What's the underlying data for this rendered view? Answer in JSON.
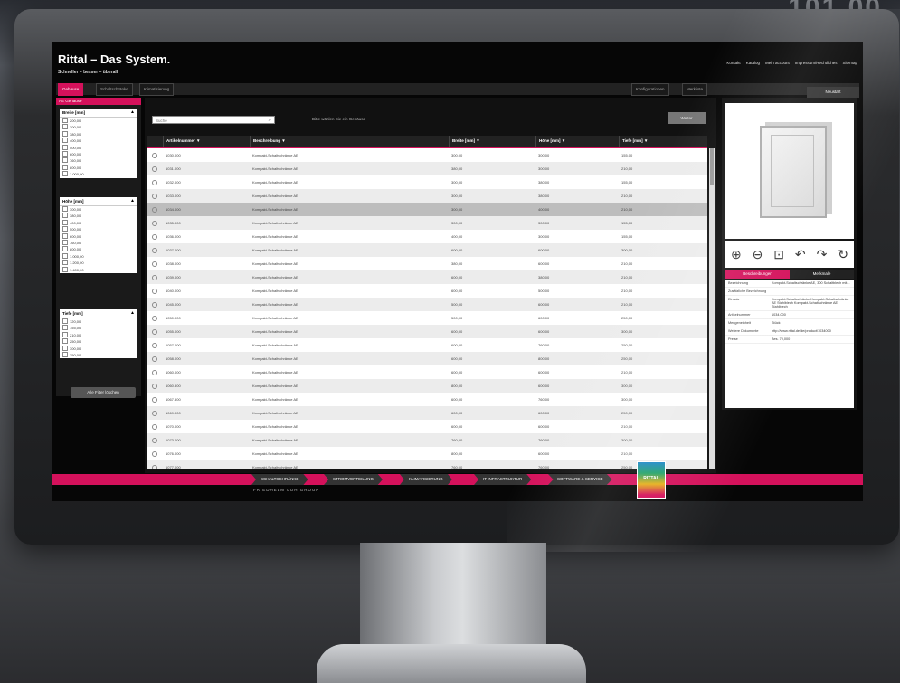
{
  "background": {
    "numbers": "101 00"
  },
  "header": {
    "title": "Rittal – Das System.",
    "tagline": "Schneller – besser – überall",
    "nav": [
      "Kontakt",
      "Katalog",
      "Mein account",
      "Impressum/Rechtliches",
      "Sitemap"
    ]
  },
  "tabs": [
    "Gehäuse",
    "Schaltschränke",
    "Klimatisierung"
  ],
  "tabs_right": [
    "Konfigurationen",
    "Merkliste"
  ],
  "topright_button": "Neustart",
  "left": {
    "head": "AE Gehäuse",
    "filters": [
      {
        "title": "Breite [mm]",
        "items": [
          "200,00",
          "300,00",
          "380,00",
          "400,00",
          "500,00",
          "600,00",
          "760,00",
          "800,00",
          "1.000,00"
        ]
      },
      {
        "title": "Höhe [mm]",
        "items": [
          "300,00",
          "380,00",
          "400,00",
          "500,00",
          "600,00",
          "760,00",
          "800,00",
          "1.000,00",
          "1.200,00",
          "1.400,00"
        ]
      },
      {
        "title": "Tiefe [mm]",
        "items": [
          "120,00",
          "155,00",
          "210,00",
          "250,00",
          "300,00",
          "350,00"
        ]
      }
    ],
    "filter_button": "Alle Filter löschen"
  },
  "main": {
    "search_placeholder": "Suche",
    "hint": "Bitte wählen Sie ein Gehäuse",
    "reset": "Weiter",
    "columns": [
      "Artikelnummer ▼",
      "Beschreibung ▼",
      "Breite [mm] ▼",
      "Höhe [mm] ▼",
      "Tiefe [mm] ▼"
    ],
    "rows": [
      [
        "1030.000",
        "Kompakt-Schaltschränke AE",
        "300,00",
        "300,00",
        "155,00"
      ],
      [
        "1031.000",
        "Kompakt-Schaltschränke AE",
        "380,00",
        "300,00",
        "210,00"
      ],
      [
        "1032.000",
        "Kompakt-Schaltschränke AE",
        "300,00",
        "380,00",
        "155,00"
      ],
      [
        "1033.000",
        "Kompakt-Schaltschränke AE",
        "300,00",
        "380,00",
        "210,00"
      ],
      [
        "1034.000",
        "Kompakt-Schaltschränke AE",
        "300,00",
        "400,00",
        "210,00"
      ],
      [
        "1035.000",
        "Kompakt-Schaltschränke AE",
        "300,00",
        "300,00",
        "155,00"
      ],
      [
        "1036.000",
        "Kompakt-Schaltschränke AE",
        "400,00",
        "300,00",
        "155,00"
      ],
      [
        "1037.000",
        "Kompakt-Schaltschränke AE",
        "600,00",
        "600,00",
        "300,00"
      ],
      [
        "1038.000",
        "Kompakt-Schaltschränke AE",
        "380,00",
        "600,00",
        "210,00"
      ],
      [
        "1039.000",
        "Kompakt-Schaltschränke AE",
        "600,00",
        "380,00",
        "210,00"
      ],
      [
        "1040.000",
        "Kompakt-Schaltschränke AE",
        "600,00",
        "500,00",
        "210,00"
      ],
      [
        "1045.000",
        "Kompakt-Schaltschränke AE",
        "500,00",
        "600,00",
        "210,00"
      ],
      [
        "1050.000",
        "Kompakt-Schaltschränke AE",
        "500,00",
        "600,00",
        "250,00"
      ],
      [
        "1055.000",
        "Kompakt-Schaltschränke AE",
        "600,00",
        "600,00",
        "300,00"
      ],
      [
        "1057.000",
        "Kompakt-Schaltschränke AE",
        "600,00",
        "760,00",
        "250,00"
      ],
      [
        "1058.000",
        "Kompakt-Schaltschränke AE",
        "600,00",
        "800,00",
        "250,00"
      ],
      [
        "1060.000",
        "Kompakt-Schaltschränke AE",
        "600,00",
        "600,00",
        "210,00"
      ],
      [
        "1060.500",
        "Kompakt-Schaltschränke AE",
        "800,00",
        "600,00",
        "300,00"
      ],
      [
        "1067.500",
        "Kompakt-Schaltschränke AE",
        "600,00",
        "760,00",
        "300,00"
      ],
      [
        "1069.000",
        "Kompakt-Schaltschränke AE",
        "600,00",
        "600,00",
        "250,00"
      ],
      [
        "1070.000",
        "Kompakt-Schaltschränke AE",
        "600,00",
        "600,00",
        "210,00"
      ],
      [
        "1073.000",
        "Kompakt-Schaltschränke AE",
        "760,00",
        "760,00",
        "300,00"
      ],
      [
        "1076.000",
        "Kompakt-Schaltschränke AE",
        "800,00",
        "600,00",
        "210,00"
      ],
      [
        "1077.000",
        "Kompakt-Schaltschränke AE",
        "760,00",
        "760,00",
        "250,00"
      ]
    ],
    "selected_row": 4
  },
  "right": {
    "tools": [
      "⊕",
      "⊖",
      "⊡",
      "↶",
      "↷",
      "↻"
    ],
    "tabs": [
      "Beschreibungen",
      "Merkmale"
    ],
    "info": [
      {
        "k": "Bezeichnung",
        "v": "Kompakt-Schaltschränke AE, 300 Schaltblech mit..."
      },
      {
        "k": "Zusätzliche Bezeichnung",
        "v": ""
      },
      {
        "k": "Einsatz",
        "v": "Kompakt-Schaltschränke Kompakt-Schaltschränke AE Stahlblech Kompakt-Schaltschränke AE Stahlblech"
      },
      {
        "k": "Artikelnummer",
        "v": "1034.000"
      },
      {
        "k": "Mengeneinheit",
        "v": "Stück"
      },
      {
        "k": "Weitere Dokumente",
        "v": "http://www.rittal.de/de/product/1034000"
      },
      {
        "k": "Preise",
        "v": "Bes. 70,000"
      }
    ]
  },
  "footer": {
    "nav": [
      "SCHALTSCHRÄNKE",
      "STROMVERTEILUNG",
      "KLIMATISIERUNG",
      "IT-INFRASTRUKTUR",
      "SOFTWARE & SERVICE"
    ],
    "sub": "FRIEDHELM LOH GROUP",
    "logo": "RITTAL"
  },
  "colors": {
    "accent": "#d4115b"
  }
}
